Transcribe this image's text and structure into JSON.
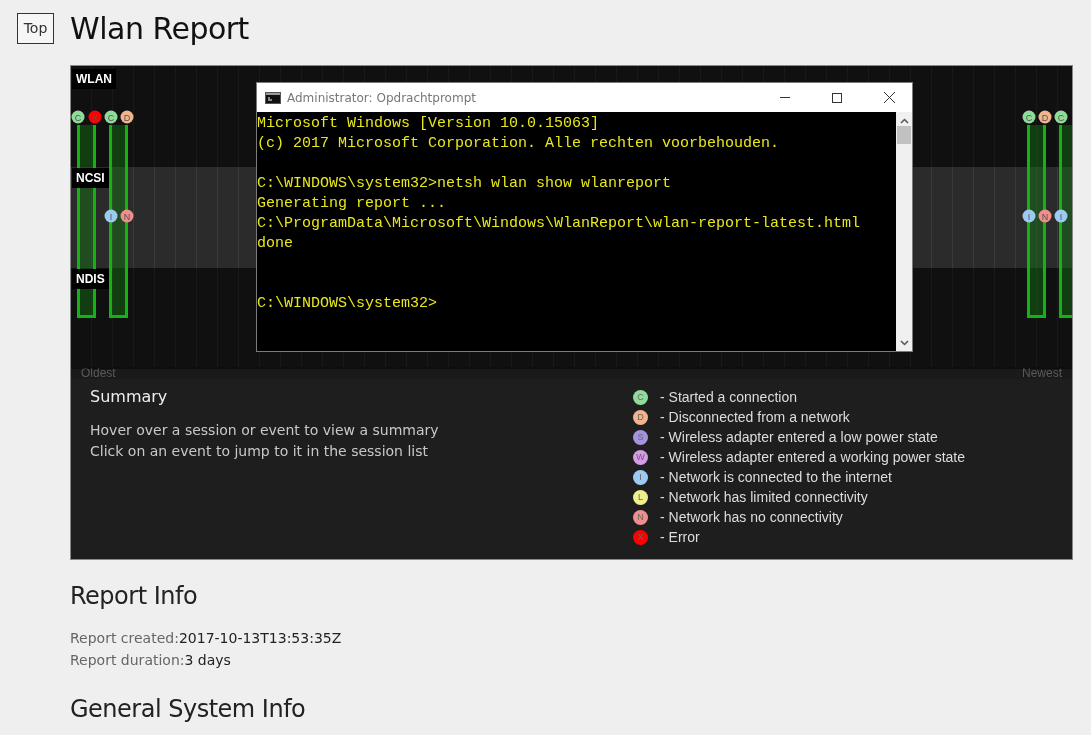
{
  "top_button": "Top",
  "title": "Wlan Report",
  "timeline": {
    "bands": [
      {
        "label": "WLAN",
        "events": [
          {
            "letter": "C",
            "color": "#8fdc9a"
          },
          {
            "letter": "X",
            "color": "#ff0000"
          },
          {
            "letter": "C",
            "color": "#8fdc9a"
          },
          {
            "letter": "D",
            "color": "#f3b48c"
          },
          {
            "letter": "C",
            "color": "#8fdc9a"
          },
          {
            "letter": "D",
            "color": "#f3b48c"
          },
          {
            "letter": "C",
            "color": "#8fdc9a"
          }
        ]
      },
      {
        "label": "NCSI",
        "events": [
          {
            "letter": "I",
            "color": "#9ccaf0"
          },
          {
            "letter": "N",
            "color": "#f08d8d"
          },
          {
            "letter": "I",
            "color": "#9ccaf0"
          },
          {
            "letter": "N",
            "color": "#f08d8d"
          },
          {
            "letter": "I",
            "color": "#9ccaf0"
          }
        ]
      },
      {
        "label": "NDIS"
      }
    ],
    "start_label": "Oldest",
    "end_label": "Newest"
  },
  "console": {
    "title": "Administrator: Opdrachtprompt",
    "blocks": [
      {
        "kind": "output",
        "lines": [
          "Microsoft Windows [Version 10.0.15063]",
          "(c) 2017 Microsoft Corporation. Alle rechten voorbehouden."
        ]
      },
      {
        "kind": "output",
        "lines": [
          "C:\\WINDOWS\\system32>netsh wlan show wlanreport",
          "Generating report ...",
          "C:\\ProgramData\\Microsoft\\Windows\\WlanReport\\wlan-report-latest.html",
          "done"
        ]
      },
      {
        "kind": "prompt",
        "lines": [
          "C:\\WINDOWS\\system32>"
        ]
      }
    ]
  },
  "summary": {
    "heading": "Summary",
    "lines": [
      "Hover over a session or event to view a summary",
      "Click on an event to jump to it in the session list"
    ]
  },
  "legend": [
    {
      "letter": "C",
      "color": "#8fdc9a",
      "text": "- Started a connection"
    },
    {
      "letter": "D",
      "color": "#f3b48c",
      "text": "- Disconnected from a network"
    },
    {
      "letter": "S",
      "color": "#a693e0",
      "text": "- Wireless adapter entered a low power state"
    },
    {
      "letter": "W",
      "color": "#d59ae8",
      "text": "- Wireless adapter entered a working power state"
    },
    {
      "letter": "I",
      "color": "#9ccaf0",
      "text": "- Network is connected to the internet"
    },
    {
      "letter": "L",
      "color": "#f0f08c",
      "text": "- Network has limited connectivity"
    },
    {
      "letter": "N",
      "color": "#f08d8d",
      "text": "- Network has no connectivity"
    },
    {
      "letter": "X",
      "color": "#ff0000",
      "text": "- Error"
    }
  ],
  "report_info": {
    "heading": "Report Info",
    "rows": [
      {
        "label": "Report created:",
        "value": "2017-10-13T13:53:35Z"
      },
      {
        "label": "Report duration:",
        "value": "3 days"
      }
    ]
  },
  "next_heading": "General System Info"
}
